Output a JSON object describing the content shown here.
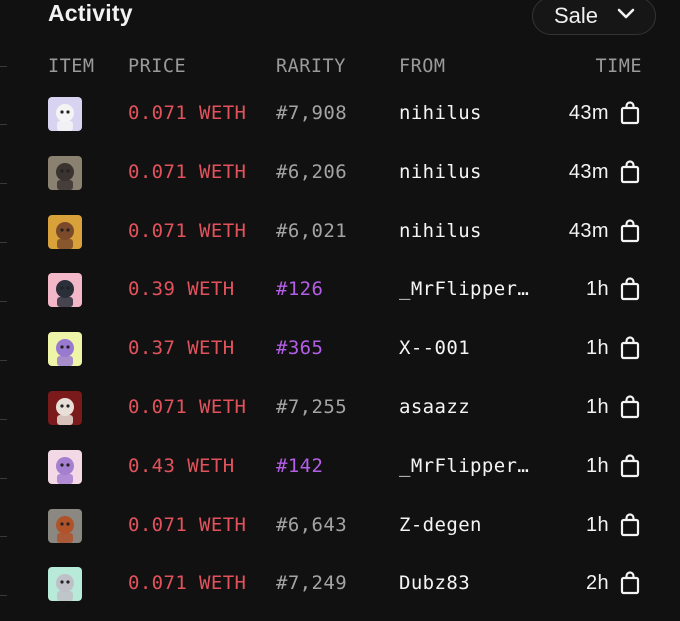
{
  "header": {
    "title": "Activity",
    "filter_label": "Sale"
  },
  "columns": {
    "item": "ITEM",
    "price": "PRICE",
    "rarity": "RARITY",
    "from": "FROM",
    "time": "TIME"
  },
  "rows": [
    {
      "price": "0.071 WETH",
      "rarity": "#7,908",
      "from": "nihilus",
      "time": "43m",
      "rare": false,
      "thumb_bg": "#d9d3f2",
      "thumb_fg": "#f4f4f4"
    },
    {
      "price": "0.071 WETH",
      "rarity": "#6,206",
      "from": "nihilus",
      "time": "43m",
      "rare": false,
      "thumb_bg": "#8a8170",
      "thumb_fg": "#3a3330"
    },
    {
      "price": "0.071 WETH",
      "rarity": "#6,021",
      "from": "nihilus",
      "time": "43m",
      "rare": false,
      "thumb_bg": "#d9a13a",
      "thumb_fg": "#7a4a2a"
    },
    {
      "price": "0.39 WETH",
      "rarity": "#126",
      "from": "_MrFlipper_",
      "time": "1h",
      "rare": true,
      "thumb_bg": "#f2b8c8",
      "thumb_fg": "#2a2f3a"
    },
    {
      "price": "0.37 WETH",
      "rarity": "#365",
      "from": "X--001",
      "time": "1h",
      "rare": true,
      "thumb_bg": "#eef5a8",
      "thumb_fg": "#9a7ad0"
    },
    {
      "price": "0.071 WETH",
      "rarity": "#7,255",
      "from": "asaazz",
      "time": "1h",
      "rare": false,
      "thumb_bg": "#7a1a1a",
      "thumb_fg": "#e8e0d8"
    },
    {
      "price": "0.43 WETH",
      "rarity": "#142",
      "from": "_MrFlipper_",
      "time": "1h",
      "rare": true,
      "thumb_bg": "#f3d8e6",
      "thumb_fg": "#a57fd0"
    },
    {
      "price": "0.071 WETH",
      "rarity": "#6,643",
      "from": "Z-degen",
      "time": "1h",
      "rare": false,
      "thumb_bg": "#8a8880",
      "thumb_fg": "#b0522a"
    },
    {
      "price": "0.071 WETH",
      "rarity": "#7,249",
      "from": "Dubz83",
      "time": "2h",
      "rare": false,
      "thumb_bg": "#b7ead8",
      "thumb_fg": "#c0c0c8"
    }
  ],
  "colors": {
    "background": "#111111",
    "price": "#e2525c",
    "rarity_default": "#a4a4a4",
    "rarity_rare": "#b35ee6",
    "header_text": "#9a9a9a"
  },
  "icons": {
    "filter_chevron": "chevron-down-icon",
    "row_action": "shopping-bag-icon"
  }
}
